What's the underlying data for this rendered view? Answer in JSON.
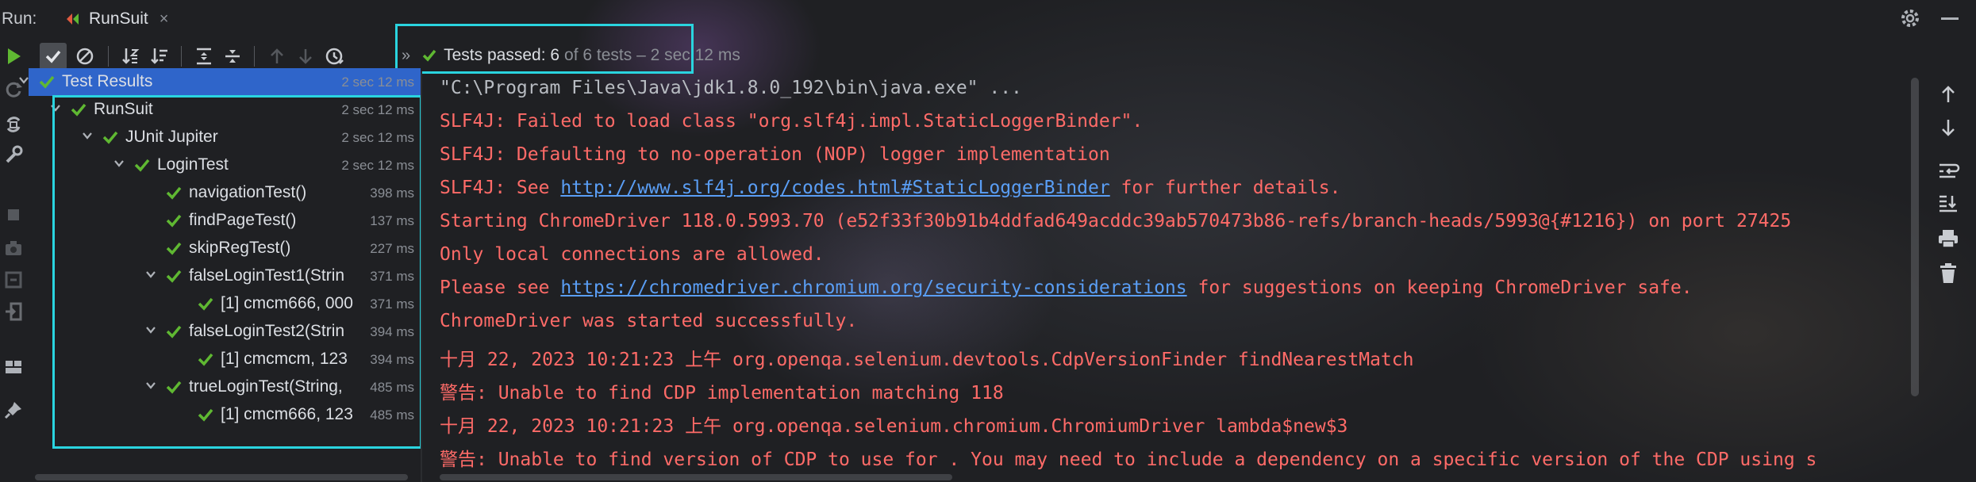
{
  "topbar": {
    "run_label": "Run:",
    "tab_label": "RunSuit",
    "close_glyph": "×"
  },
  "status": {
    "chevron": "»",
    "passed_text": "Tests passed: 6",
    "rest_text": "of 6 tests – 2 sec 12 ms"
  },
  "tree": {
    "rows": [
      {
        "label": "Test Results",
        "time": "2 sec 12 ms",
        "level": 0,
        "expanded": true,
        "selected": true
      },
      {
        "label": "RunSuit",
        "time": "2 sec 12 ms",
        "level": 1,
        "expanded": true
      },
      {
        "label": "JUnit Jupiter",
        "time": "2 sec 12 ms",
        "level": 2,
        "expanded": true
      },
      {
        "label": "LoginTest",
        "time": "2 sec 12 ms",
        "level": 3,
        "expanded": true
      },
      {
        "label": "navigationTest()",
        "time": "398 ms",
        "level": 4
      },
      {
        "label": "findPageTest()",
        "time": "137 ms",
        "level": 4
      },
      {
        "label": "skipRegTest()",
        "time": "227 ms",
        "level": 4
      },
      {
        "label": "falseLoginTest1(Strin",
        "time": "371 ms",
        "level": 4,
        "expanded": true
      },
      {
        "label": "[1] cmcm666, 000",
        "time": "371 ms",
        "level": 5
      },
      {
        "label": "falseLoginTest2(Strin",
        "time": "394 ms",
        "level": 4,
        "expanded": true
      },
      {
        "label": "[1] cmcmcm, 123",
        "time": "394 ms",
        "level": 5
      },
      {
        "label": "trueLoginTest(String,",
        "time": "485 ms",
        "level": 4,
        "expanded": true
      },
      {
        "label": "[1] cmcm666, 123",
        "time": "485 ms",
        "level": 5
      }
    ]
  },
  "console": {
    "lines": [
      {
        "type": "cmd",
        "text": "\"C:\\Program Files\\Java\\jdk1.8.0_192\\bin\\java.exe\" ..."
      },
      {
        "type": "err",
        "text": "SLF4J: Failed to load class \"org.slf4j.impl.StaticLoggerBinder\"."
      },
      {
        "type": "err",
        "text": "SLF4J: Defaulting to no-operation (NOP) logger implementation"
      },
      {
        "type": "err",
        "pre": "SLF4J: See ",
        "link": "http://www.slf4j.org/codes.html#StaticLoggerBinder",
        "post": " for further details."
      },
      {
        "type": "err",
        "text": "Starting ChromeDriver 118.0.5993.70 (e52f33f30b91b4ddfad649acddc39ab570473b86-refs/branch-heads/5993@{#1216}) on port 27425"
      },
      {
        "type": "err",
        "text": "Only local connections are allowed."
      },
      {
        "type": "err",
        "pre": "Please see ",
        "link": "https://chromedriver.chromium.org/security-considerations",
        "post": " for suggestions on keeping ChromeDriver safe."
      },
      {
        "type": "err",
        "text": "ChromeDriver was started successfully."
      },
      {
        "type": "err",
        "text": "十月 22, 2023 10:21:23 上午 org.openqa.selenium.devtools.CdpVersionFinder findNearestMatch"
      },
      {
        "type": "err",
        "text": "警告: Unable to find CDP implementation matching 118"
      },
      {
        "type": "err",
        "text": "十月 22, 2023 10:21:23 上午 org.openqa.selenium.chromium.ChromiumDriver lambda$new$3"
      },
      {
        "type": "err",
        "text": "警告: Unable to find version of CDP to use for . You may need to include a dependency on a specific version of the CDP using s"
      }
    ]
  },
  "colors": {
    "pass_green": "#5fb832",
    "error_red": "#ff6b68",
    "link_blue": "#5a9ef5",
    "highlight_cyan": "#2ad4df",
    "selection_blue": "#2f65ca"
  },
  "icons": {
    "left_bar": [
      "rerun-icon",
      "rerun-failed-icon",
      "toggle-auto-test-icon",
      "settings-wrench-icon",
      "stop-icon",
      "camera-icon",
      "restore-layout-icon",
      "exit-icon",
      "layout-icon",
      "pin-icon"
    ],
    "test_toolbar": [
      "show-passed-icon",
      "show-ignored-icon",
      "sort-alpha-icon",
      "sort-duration-icon",
      "expand-all-icon",
      "collapse-all-icon",
      "previous-failed-icon",
      "next-failed-icon",
      "test-history-icon"
    ],
    "right_bar": [
      "up-trace-icon",
      "down-trace-icon",
      "soft-wrap-icon",
      "scroll-to-end-icon",
      "print-icon",
      "clear-all-icon"
    ]
  }
}
